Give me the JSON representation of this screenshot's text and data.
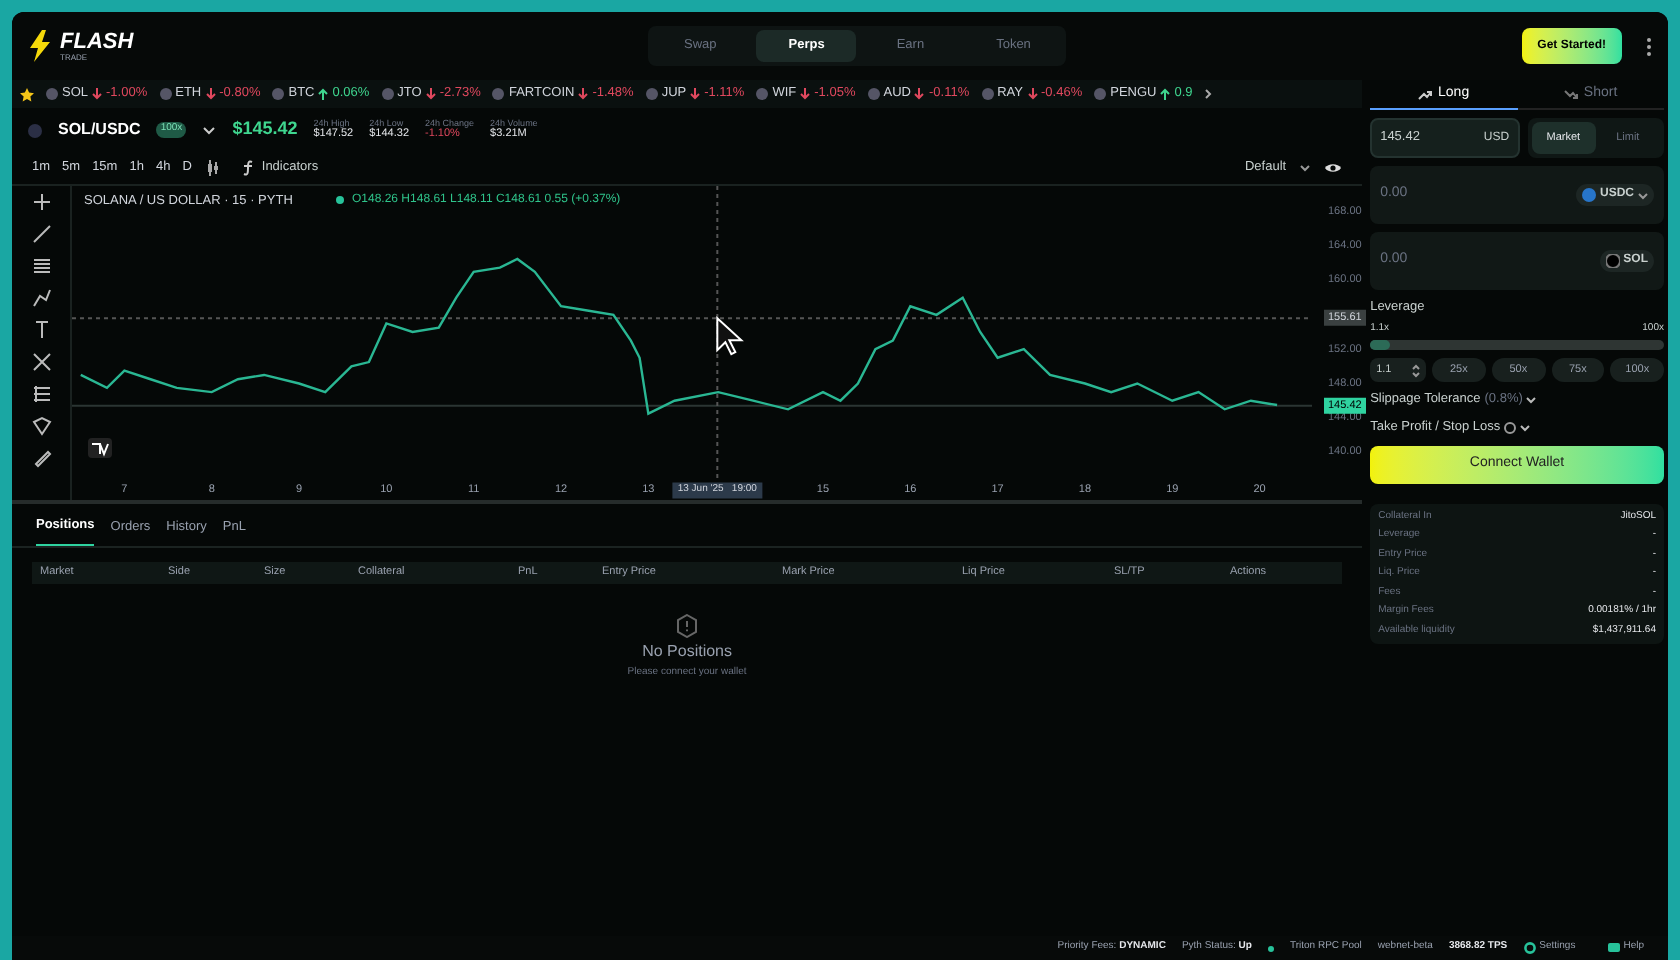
{
  "header": {
    "logo": "FLASH",
    "logo_sub": "TRADE",
    "nav": [
      {
        "label": "Swap",
        "selected": false
      },
      {
        "label": "Perps",
        "selected": true
      },
      {
        "label": "Earn",
        "selected": false
      },
      {
        "label": "Token",
        "selected": false
      }
    ],
    "cta": "Get Started!"
  },
  "ticker": [
    {
      "symbol": "SOL",
      "change": "-1.00%",
      "up": false
    },
    {
      "symbol": "ETH",
      "change": "-0.80%",
      "up": false
    },
    {
      "symbol": "BTC",
      "change": "0.06%",
      "up": true
    },
    {
      "symbol": "JTO",
      "change": "-2.73%",
      "up": false
    },
    {
      "symbol": "FARTCOIN",
      "change": "-1.48%",
      "up": false
    },
    {
      "symbol": "JUP",
      "change": "-1.11%",
      "up": false
    },
    {
      "symbol": "WIF",
      "change": "-1.05%",
      "up": false
    },
    {
      "symbol": "AUD",
      "change": "-0.11%",
      "up": false
    },
    {
      "symbol": "RAY",
      "change": "-0.46%",
      "up": false
    },
    {
      "symbol": "PENGU",
      "change": "0.9",
      "up": true
    }
  ],
  "market": {
    "pair": "SOL/USDC",
    "badge": "100x",
    "price": "$145.42",
    "stats": [
      {
        "label": "24h High",
        "value": "$147.52",
        "kind": "plain"
      },
      {
        "label": "24h Low",
        "value": "$144.32",
        "kind": "plain"
      },
      {
        "label": "24h Change",
        "value": "-1.10%",
        "kind": "down"
      },
      {
        "label": "24h Volume",
        "value": "$3.21M",
        "kind": "plain"
      }
    ]
  },
  "chart_toolbar": {
    "intervals": [
      "1m",
      "5m",
      "15m",
      "1h",
      "4h",
      "D"
    ],
    "indicators": "Indicators",
    "layout": "Default"
  },
  "chart": {
    "legend": "SOLANA / US DOLLAR · 15 · PYTH",
    "ohlc": "O148.26 H148.61 L148.11 C148.61 0.55 (+0.37%)",
    "chart_data": {
      "type": "line",
      "x": [
        6.5,
        6.8,
        7,
        7.3,
        7.6,
        8,
        8.3,
        8.6,
        9,
        9.3,
        9.6,
        9.8,
        10,
        10.3,
        10.6,
        10.8,
        11,
        11.3,
        11.5,
        11.7,
        12,
        12.3,
        12.6,
        12.8,
        12.9,
        13,
        13.3,
        13.8,
        14.2,
        14.6,
        15,
        15.2,
        15.4,
        15.6,
        15.8,
        16,
        16.3,
        16.6,
        16.8,
        17,
        17.3,
        17.6,
        18,
        18.3,
        18.6,
        19,
        19.3,
        19.6,
        19.9,
        20.2
      ],
      "series": [
        {
          "color": "#2ab793",
          "values": [
            149,
            147.5,
            149.5,
            148.5,
            147.5,
            147,
            148.5,
            149,
            148,
            147,
            150,
            150.5,
            155,
            154,
            154.5,
            158,
            161,
            161.5,
            162.5,
            161,
            157,
            156.5,
            156,
            153,
            151,
            144.5,
            146,
            147,
            146,
            145,
            147,
            146,
            148,
            152,
            153,
            157,
            156,
            158,
            154,
            151,
            152,
            149,
            148,
            147,
            148,
            146,
            147,
            145,
            146,
            145.5
          ]
        }
      ],
      "xlim": [
        6.4,
        20.6
      ],
      "ylim": [
        137,
        171
      ],
      "xticks": [
        7,
        8,
        9,
        10,
        11,
        12,
        13,
        15,
        16,
        17,
        18,
        19,
        20
      ],
      "yticks": [
        {
          "value": 140,
          "label": "140.00"
        },
        {
          "value": 144,
          "label": "144.00"
        },
        {
          "value": 148,
          "label": "148.00"
        },
        {
          "value": 152,
          "label": "152.00"
        },
        {
          "value": 160,
          "label": "160.00"
        },
        {
          "value": 164,
          "label": "164.00"
        },
        {
          "value": 168,
          "label": "168.00"
        }
      ],
      "ref_lines": [
        {
          "axis": "y",
          "value": 145.42,
          "label": "145.42"
        },
        {
          "axis": "y",
          "value": 155.61,
          "label": "155.61"
        },
        {
          "axis": "x",
          "value": 13.79
        }
      ]
    },
    "crosshair_time": "13 Jun '25   19:00"
  },
  "positions": {
    "tabs": [
      {
        "label": "Positions",
        "selected": true
      },
      {
        "label": "Orders",
        "selected": false
      },
      {
        "label": "History",
        "selected": false
      },
      {
        "label": "PnL",
        "selected": false
      }
    ],
    "columns": [
      "Market",
      "Side",
      "Size",
      "Collateral",
      "PnL",
      "Entry Price",
      "Mark Price",
      "Liq Price",
      "SL/TP",
      "Actions"
    ],
    "empty_title": "No Positions",
    "empty_text": "Please connect your wallet"
  },
  "order": {
    "sides": [
      {
        "label": "Long",
        "selected": true
      },
      {
        "label": "Short",
        "selected": false
      }
    ],
    "price": "145.42",
    "price_unit": "USD",
    "types": [
      {
        "label": "Market",
        "selected": true
      },
      {
        "label": "Limit",
        "selected": false
      }
    ],
    "pay": {
      "placeholder": "0.00",
      "token": "USDC"
    },
    "receive": {
      "placeholder": "0.00",
      "token": "SOL"
    },
    "leverage_label": "Leverage",
    "lev_min": "1.1x",
    "lev_max": "100x",
    "level": 0.03,
    "lev_input": "1.1",
    "presets": [
      "25x",
      "50x",
      "75x",
      "100x"
    ],
    "slippage": "Slippage Tolerance",
    "slippage_value": "(0.8%)",
    "tpsl": "Take Profit / Stop Loss",
    "connect": "Connect Wallet",
    "info": [
      {
        "label": "Collateral In",
        "value": "JitoSOL"
      },
      {
        "label": "Leverage",
        "value": "-"
      },
      {
        "label": "Entry Price",
        "value": "-"
      },
      {
        "label": "Liq. Price",
        "value": "-"
      },
      {
        "label": "Fees",
        "value": "-"
      },
      {
        "label": "Margin Fees",
        "value": "0.00181% / 1hr"
      },
      {
        "label": "Available liquidity",
        "value": "$1,437,911.64"
      }
    ]
  },
  "status_bar": {
    "priority_label": "Priority Fees:",
    "priority_value": "DYNAMIC",
    "pyth_label": "Pyth Status:",
    "pyth_value": "Up",
    "rpc": "Triton RPC Pool",
    "network": "webnet-beta",
    "tps": "3868.82 TPS",
    "settings": "Settings",
    "help": "Help"
  }
}
